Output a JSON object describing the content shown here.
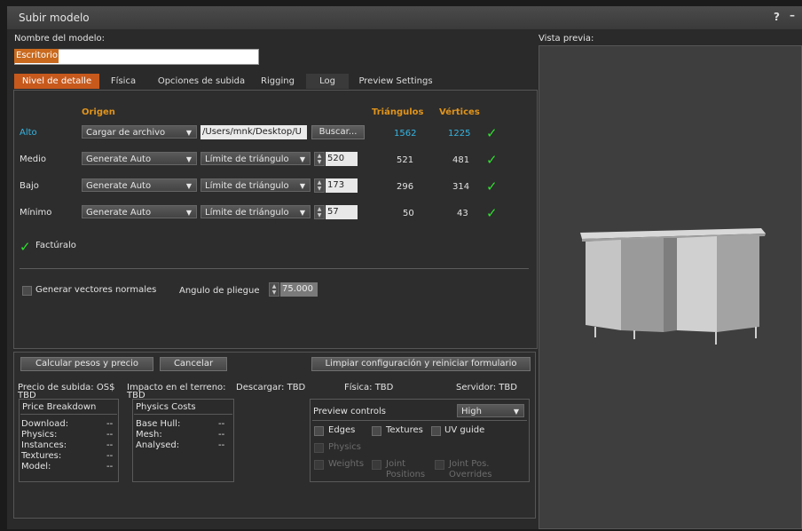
{
  "window": {
    "title": "Subir modelo",
    "help": "?",
    "minimize": "–"
  },
  "model_name": {
    "label": "Nombre del modelo:",
    "value": "Escritorio"
  },
  "tabs": [
    {
      "label": "Nivel de detalle",
      "active": true
    },
    {
      "label": "Física",
      "active": false
    },
    {
      "label": "Opciones de subida",
      "active": false
    },
    {
      "label": "Rigging",
      "active": false
    },
    {
      "label": "Log",
      "active": false
    },
    {
      "label": "Preview Settings",
      "active": false
    }
  ],
  "lod": {
    "header_origin": "Origen",
    "header_triangles": "Triángulos",
    "header_vertices": "Vértices",
    "rows": [
      {
        "label": "Alto",
        "source": "Cargar de archivo",
        "path": "/Users/mnk/Desktop/U",
        "browse": "Buscar...",
        "triangles": "1562",
        "vertices": "1225"
      },
      {
        "label": "Medio",
        "source": "Generate Auto",
        "mode": "Límite de triángulo",
        "limit": "520",
        "triangles": "521",
        "vertices": "481"
      },
      {
        "label": "Bajo",
        "source": "Generate Auto",
        "mode": "Límite de triángulo",
        "limit": "173",
        "triangles": "296",
        "vertices": "314"
      },
      {
        "label": "Mínimo",
        "source": "Generate Auto",
        "mode": "Límite de triángulo",
        "limit": "57",
        "triangles": "50",
        "vertices": "43"
      }
    ],
    "status": "Factúralo",
    "generate_normals": "Generar vectores normales",
    "crease_label": "Angulo de pliegue",
    "crease_value": "75.000"
  },
  "actions": {
    "calculate": "Calcular pesos y precio",
    "cancel": "Cancelar",
    "reset": "Limpiar configuración y reiniciar formulario"
  },
  "costs": {
    "upload_fee": "Precio de subida: OS$",
    "upload_fee_value": "TBD",
    "land_impact": "Impacto en el terreno:",
    "land_impact_value": "TBD",
    "download": "Descargar: TBD",
    "physics": "Física: TBD",
    "server": "Servidor: TBD"
  },
  "price_breakdown": {
    "title": "Price Breakdown",
    "items": [
      {
        "label": "Download:",
        "value": "--"
      },
      {
        "label": "Physics:",
        "value": "--"
      },
      {
        "label": "Instances:",
        "value": "--"
      },
      {
        "label": "Textures:",
        "value": "--"
      },
      {
        "label": "Model:",
        "value": "--"
      }
    ]
  },
  "physics_costs": {
    "title": "Physics Costs",
    "items": [
      {
        "label": "Base Hull:",
        "value": "--"
      },
      {
        "label": "Mesh:",
        "value": "--"
      },
      {
        "label": "Analysed:",
        "value": "--"
      }
    ]
  },
  "preview_controls": {
    "title": "Preview controls",
    "quality": "High",
    "edges": "Edges",
    "textures": "Textures",
    "uv_guide": "UV guide",
    "physics": "Physics",
    "weights": "Weights",
    "joint_positions_1": "Joint",
    "joint_positions_2": "Positions",
    "joint_overrides_1": "Joint Pos.",
    "joint_overrides_2": "Overrides"
  },
  "preview": {
    "label": "Vista previa:"
  },
  "colors": {
    "accent": "#c7591c",
    "header": "#e0941c",
    "highlight": "#35b6e3",
    "check": "#2ee02e"
  }
}
